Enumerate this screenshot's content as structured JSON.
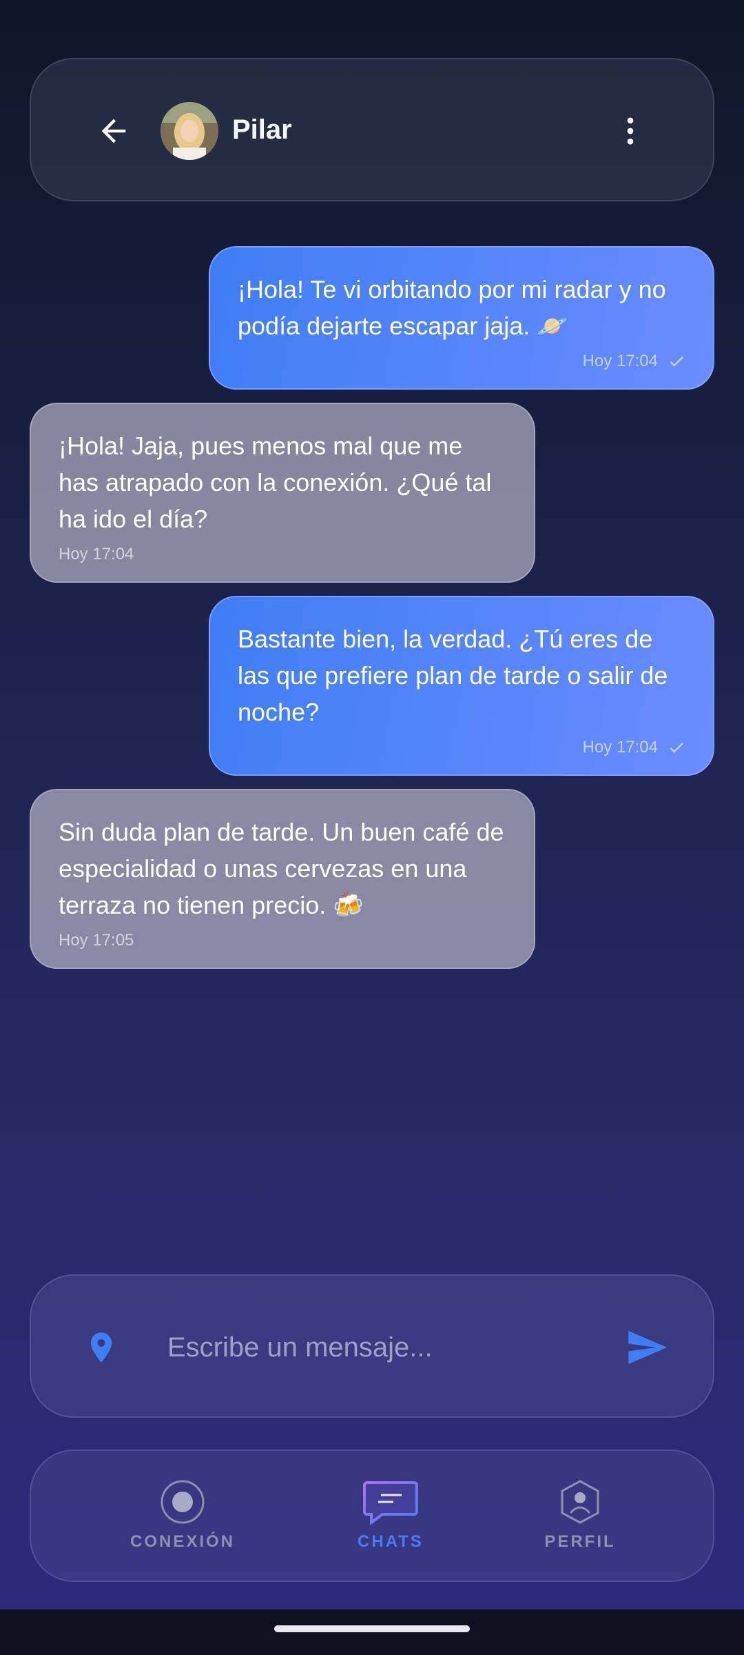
{
  "header": {
    "contact_name": "Pilar"
  },
  "messages": [
    {
      "direction": "out",
      "text": "¡Hola! Te vi orbitando por mi radar y no podía dejarte escapar jaja. 🪐",
      "time": "Hoy 17:04",
      "status": "sent-check"
    },
    {
      "direction": "in",
      "text": "¡Hola! Jaja, pues menos mal que me has atrapado con la conexión. ¿Qué tal ha ido el día?",
      "time": "Hoy 17:04"
    },
    {
      "direction": "out",
      "text": "Bastante bien, la verdad. ¿Tú eres de las que prefiere plan de tarde o salir de noche?",
      "time": "Hoy 17:04",
      "status": "sent-check"
    },
    {
      "direction": "in",
      "text": "Sin duda plan de tarde. Un buen café de especialidad o unas cervezas en una terraza no tienen precio. 🍻",
      "time": "Hoy 17:05"
    }
  ],
  "composer": {
    "placeholder": "Escribe un mensaje..."
  },
  "nav": {
    "items": [
      {
        "label": "CONEXIÓN",
        "icon": "connection-icon",
        "active": false
      },
      {
        "label": "CHATS",
        "icon": "chat-icon",
        "active": true
      },
      {
        "label": "PERFIL",
        "icon": "profile-icon",
        "active": false
      }
    ]
  },
  "colors": {
    "accent": "#4b7bf2",
    "outgoing_bubble": "#5585f8",
    "incoming_bubble": "#9a9ab0"
  }
}
